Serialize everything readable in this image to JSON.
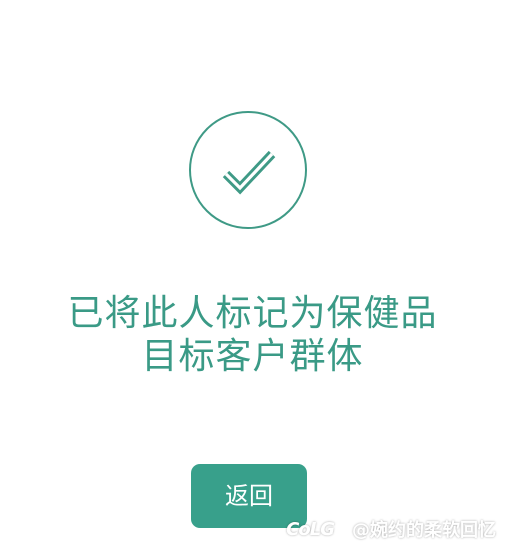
{
  "success": {
    "icon": "check-icon",
    "color": "#3f9a86"
  },
  "message": {
    "line_1": "已将此人标记为保健品",
    "line_2": "目标客户群体"
  },
  "button": {
    "label": "返回",
    "color": "#38a08b"
  },
  "watermark": {
    "logo": "CoLG",
    "text": "@婉约的柔软回忆"
  }
}
